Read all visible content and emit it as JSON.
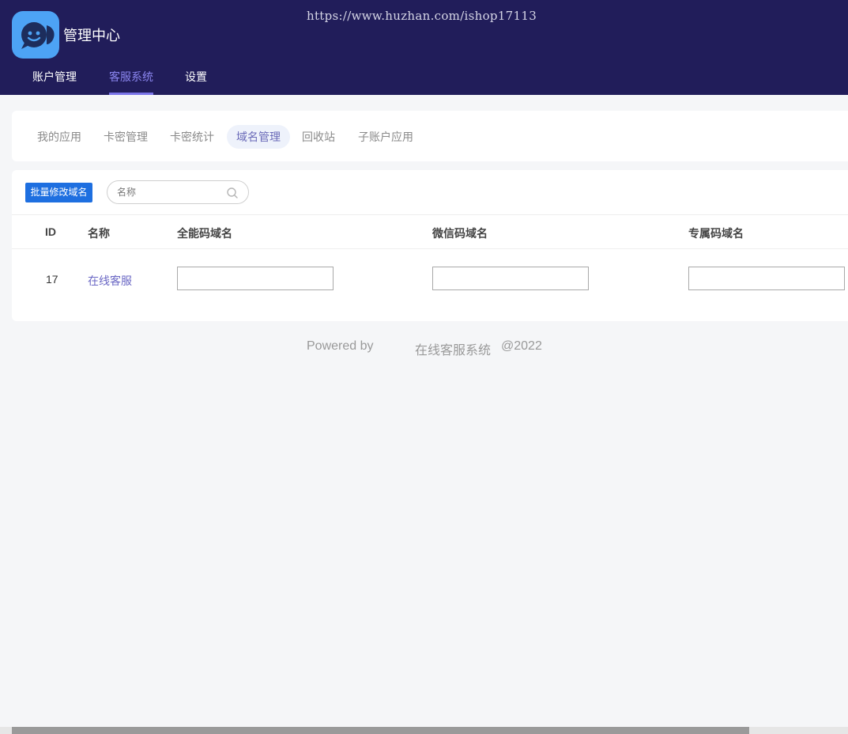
{
  "header": {
    "watermark": "https://www.huzhan.com/ishop17113",
    "app_title": "管理中心",
    "logo_icon": "chat-bubble-face-logo",
    "nav": [
      {
        "label": "账户管理",
        "active": false
      },
      {
        "label": "客服系统",
        "active": true
      },
      {
        "label": "设置",
        "active": false
      }
    ]
  },
  "subtabs": [
    {
      "label": "我的应用",
      "active": false
    },
    {
      "label": "卡密管理",
      "active": false
    },
    {
      "label": "卡密统计",
      "active": false
    },
    {
      "label": "域名管理",
      "active": true
    },
    {
      "label": "回收站",
      "active": false
    },
    {
      "label": "子账户应用",
      "active": false
    }
  ],
  "toolbar": {
    "batch_button": "批量修改域名",
    "search_placeholder": "名称",
    "search_value": ""
  },
  "table": {
    "columns": [
      "ID",
      "名称",
      "全能码域名",
      "微信码域名",
      "专属码域名"
    ],
    "rows": [
      {
        "id": "17",
        "name": "在线客服",
        "all_domain": "",
        "wechat_domain": "",
        "exclusive_domain": ""
      }
    ]
  },
  "footer": {
    "powered_by": "Powered by",
    "system_name": "在线客服系统",
    "year": "@2022"
  },
  "colors": {
    "header_bg": "#211d5a",
    "accent": "#7a74e8",
    "primary_button": "#1e6fe0",
    "link": "#6a67c4"
  }
}
